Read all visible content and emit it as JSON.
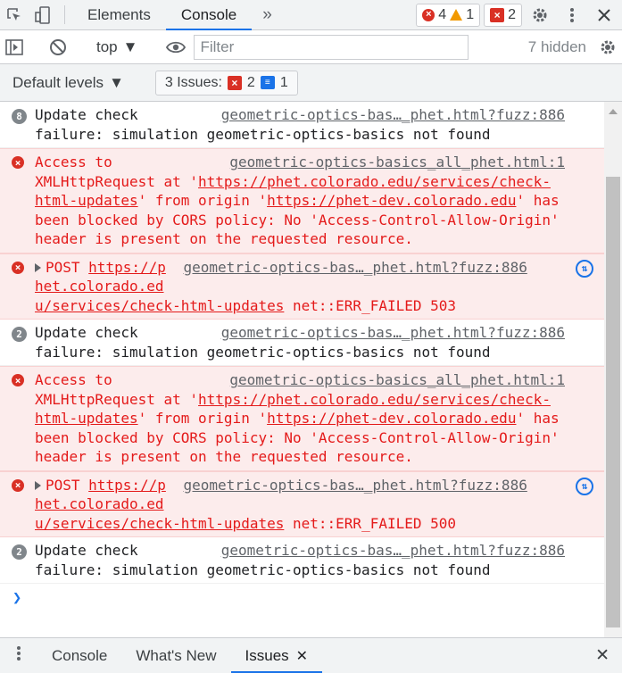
{
  "topbar": {
    "tabs": [
      "Elements",
      "Console"
    ],
    "active_tab": "Console",
    "more_tabs": "»",
    "error_count": "4",
    "warning_count": "1",
    "issue_count": "2"
  },
  "toolbar": {
    "context": "top",
    "filter_placeholder": "Filter",
    "hidden_label": "7 hidden"
  },
  "levels": {
    "default_levels": "Default levels",
    "issues_label": "3 Issues:",
    "issues_errors": "2",
    "issues_info": "1"
  },
  "messages": [
    {
      "type": "info",
      "badge": "8",
      "source": "geometric-optics-bas…_phet.html?fuzz:886",
      "text": "Update check failure: simulation geometric-optics-basics not found"
    },
    {
      "type": "error",
      "source": "geometric-optics-basics_all_phet.html:1",
      "pre": "Access to XMLHttpRequest at '",
      "url1": "https://phet.colorado.edu/services/check-html-updates",
      "mid": "' from origin '",
      "url2": "https://phet-dev.colorado.edu",
      "post": "' has been blocked by CORS policy: No 'Access-Control-Allow-Origin' header is present on the requested resource."
    },
    {
      "type": "network",
      "method": "POST",
      "url_a": "https://p",
      "source": "geometric-optics-bas…_phet.html?fuzz:886",
      "url_b": "het.colorado.ed",
      "url_c": "u/services/check-html-updates",
      "status": "net::ERR_FAILED 503"
    },
    {
      "type": "info",
      "badge": "2",
      "source": "geometric-optics-bas…_phet.html?fuzz:886",
      "text": "Update check failure: simulation geometric-optics-basics not found"
    },
    {
      "type": "error",
      "source": "geometric-optics-basics_all_phet.html:1",
      "pre": "Access to XMLHttpRequest at '",
      "url1": "https://phet.colorado.edu/services/check-html-updates",
      "mid": "' from origin '",
      "url2": "https://phet-dev.colorado.edu",
      "post": "' has been blocked by CORS policy: No 'Access-Control-Allow-Origin' header is present on the requested resource."
    },
    {
      "type": "network",
      "method": "POST",
      "url_a": "https://p",
      "source": "geometric-optics-bas…_phet.html?fuzz:886",
      "url_b": "het.colorado.ed",
      "url_c": "u/services/check-html-updates",
      "status": "net::ERR_FAILED 500"
    },
    {
      "type": "info",
      "badge": "2",
      "source": "geometric-optics-bas…_phet.html?fuzz:886",
      "text": "Update check failure: simulation geometric-optics-basics not found"
    }
  ],
  "drawer": {
    "tabs": [
      "Console",
      "What's New",
      "Issues"
    ],
    "active_tab": "Issues"
  }
}
